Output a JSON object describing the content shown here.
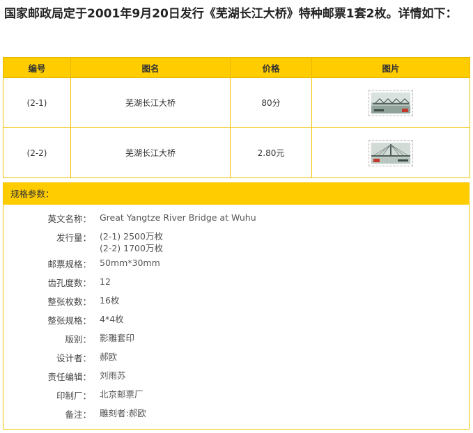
{
  "intro": "国家邮政局定于2001年9月20日发行《芜湖长江大桥》特种邮票1套2枚。详情如下：",
  "table": {
    "headers": [
      "编号",
      "图名",
      "价格",
      "图片"
    ],
    "rows": [
      {
        "code": "(2-1)",
        "name": "芜湖长江大桥",
        "price": "80分",
        "image_label": "stamp-2-1"
      },
      {
        "code": "(2-2)",
        "name": "芜湖长江大桥",
        "price": "2.80元",
        "image_label": "stamp-2-2"
      }
    ]
  },
  "spec": {
    "title": "规格参数：",
    "rows": [
      {
        "label": "英文名称：",
        "value": "Great Yangtze River Bridge at Wuhu"
      },
      {
        "label": "发行量：",
        "value": "(2-1) 2500万枚",
        "value2": "(2-2) 1700万枚"
      },
      {
        "label": "邮票规格：",
        "value": "50mm*30mm"
      },
      {
        "label": "齿孔度数：",
        "value": "12"
      },
      {
        "label": "整张枚数：",
        "value": "16枚"
      },
      {
        "label": "整张规格：",
        "value": "4*4枚"
      },
      {
        "label": "版别：",
        "value": "影雕套印"
      },
      {
        "label": "设计者：",
        "value": "郝欧"
      },
      {
        "label": "责任编辑：",
        "value": "刘雨苏"
      },
      {
        "label": "印制厂：",
        "value": "北京邮票厂"
      },
      {
        "label": "备注：",
        "value": "雕刻者:郝欧"
      }
    ]
  },
  "colors": {
    "header_bg": "#ffcc00",
    "border": "#f2c200"
  }
}
